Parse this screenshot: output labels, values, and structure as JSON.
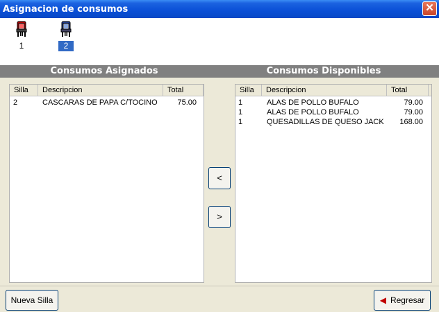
{
  "window": {
    "title": "Asignacion de consumos",
    "close": "✕"
  },
  "seats": [
    {
      "label": "1",
      "selected": false,
      "icon": "chair-red-icon"
    },
    {
      "label": "2",
      "selected": true,
      "icon": "chair-blue-icon"
    }
  ],
  "left": {
    "header": "Consumos Asignados",
    "columns": {
      "silla": "Silla",
      "descripcion": "Descripcion",
      "total": "Total"
    },
    "rows": [
      {
        "silla": "2",
        "descripcion": "CASCARAS DE PAPA C/TOCINO",
        "total": "75.00"
      }
    ]
  },
  "right": {
    "header": "Consumos Disponibles",
    "columns": {
      "silla": "Silla",
      "descripcion": "Descripcion",
      "total": "Total"
    },
    "rows": [
      {
        "silla": "1",
        "descripcion": "ALAS DE POLLO BUFALO",
        "total": "79.00"
      },
      {
        "silla": "1",
        "descripcion": "ALAS DE POLLO BUFALO",
        "total": "79.00"
      },
      {
        "silla": "1",
        "descripcion": "QUESADILLAS DE QUESO JACK",
        "total": "168.00"
      }
    ]
  },
  "buttons": {
    "move_left": "<",
    "move_right": ">",
    "nueva_silla": "Nueva Silla",
    "regresar": "Regresar"
  },
  "colors": {
    "titlebar": "#0a4fd6",
    "section_bar": "#808080",
    "selection": "#316ac5"
  }
}
